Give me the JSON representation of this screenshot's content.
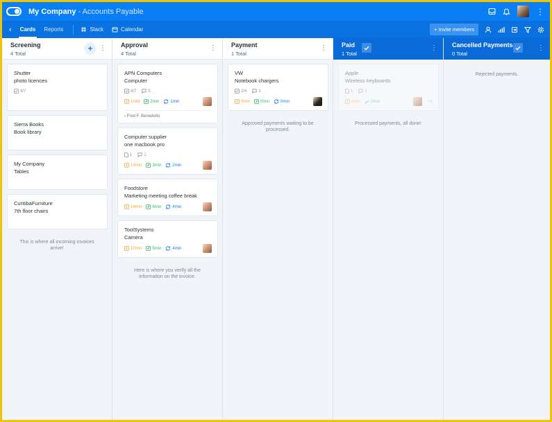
{
  "app": {
    "company": "My Company",
    "subtitle": "- Accounts Payable"
  },
  "nav": {
    "tabs": [
      {
        "label": "Cards",
        "active": true
      },
      {
        "label": "Reports",
        "active": false
      }
    ],
    "links": [
      {
        "label": "Slack",
        "icon": "slack-icon"
      },
      {
        "label": "Calendar",
        "icon": "calendar-icon"
      }
    ],
    "invite_label": "+ Invite members"
  },
  "colors": {
    "topbar": "#0a7ff5",
    "navbar": "#0a72e0",
    "accent": "#1a7ef2",
    "done_header": "#0a6ad8"
  },
  "columns": [
    {
      "title": "Screening",
      "count": "4 Total",
      "cards": [
        {
          "title": "Shutter",
          "subtitle": "photo licences",
          "meta_checklist": "4/7"
        },
        {
          "title": "Sierra Books",
          "subtitle": "Book library"
        },
        {
          "title": "My Company",
          "subtitle": "Tables"
        },
        {
          "title": "CuritibaFurniture",
          "subtitle": "7th floor chairs"
        }
      ],
      "empty_text": "This is where all incoming invoices arrive!"
    },
    {
      "title": "Approval",
      "count": "4 Total",
      "cards": [
        {
          "title": "APN Computers",
          "subtitle": "Computer",
          "meta_checklist": "4/7",
          "meta_comments": "5",
          "t1": "1h4d",
          "t2": "2min",
          "t3": "1min",
          "assignee": "Fred F. Benedetto"
        },
        {
          "title": "Computer supplier",
          "subtitle": "one macbook pro",
          "meta_attach": "1",
          "meta_comments": "1",
          "t1": "14min",
          "t2": "3min",
          "t3": "2min"
        },
        {
          "title": "Foodstore",
          "subtitle": "Marketing meeting coffee break",
          "t1": "14min",
          "t2": "6min",
          "t3": "4min"
        },
        {
          "title": "ToolSystems",
          "subtitle": "Camera",
          "t1": "10min",
          "t2": "5min",
          "t3": "4min"
        }
      ],
      "empty_text": "Here is where you verify all the information on the invoice."
    },
    {
      "title": "Payment",
      "count": "1 Total",
      "cards": [
        {
          "title": "VW",
          "subtitle": "Notebook chargers",
          "meta_checklist": "2/4",
          "meta_comments": "1",
          "t1": "0min",
          "t2": "0min",
          "t3": "0min"
        }
      ],
      "empty_text": "Approved payments waiting to be processed."
    },
    {
      "title": "Paid",
      "count": "1 Total",
      "cards": [
        {
          "title": "Apple",
          "subtitle": "Wireless keyboards",
          "meta_attach": "1",
          "meta_comments": "1",
          "t1": "0min",
          "t2": "2min",
          "extra": "+1"
        }
      ],
      "empty_text": "Processed payments, all done!"
    },
    {
      "title": "Cancelled Payments",
      "count": "0 Total",
      "cards": [],
      "empty_text": "Rejected payments."
    }
  ]
}
